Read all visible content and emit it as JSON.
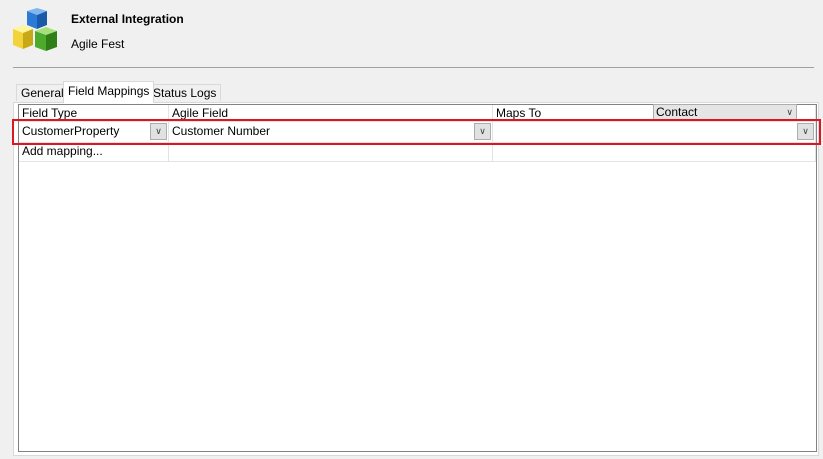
{
  "header": {
    "title": "External Integration",
    "subtitle": "Agile Fest",
    "icon": "cubes-icon"
  },
  "tabs": [
    {
      "label": "General",
      "active": false
    },
    {
      "label": "Field Mappings",
      "active": true
    },
    {
      "label": "Status Logs",
      "active": false
    }
  ],
  "grid": {
    "columns": [
      "Field Type",
      "Agile Field",
      "Maps To"
    ],
    "rows": [
      {
        "field_type": "CustomerProperty",
        "agile_field": "Customer Number",
        "maps_to": ""
      }
    ],
    "add_row_label": "Add mapping..."
  },
  "contact_dropdown": {
    "value": "Contact"
  },
  "colors": {
    "highlight": "#e0141f",
    "background": "#f0f0f0"
  }
}
